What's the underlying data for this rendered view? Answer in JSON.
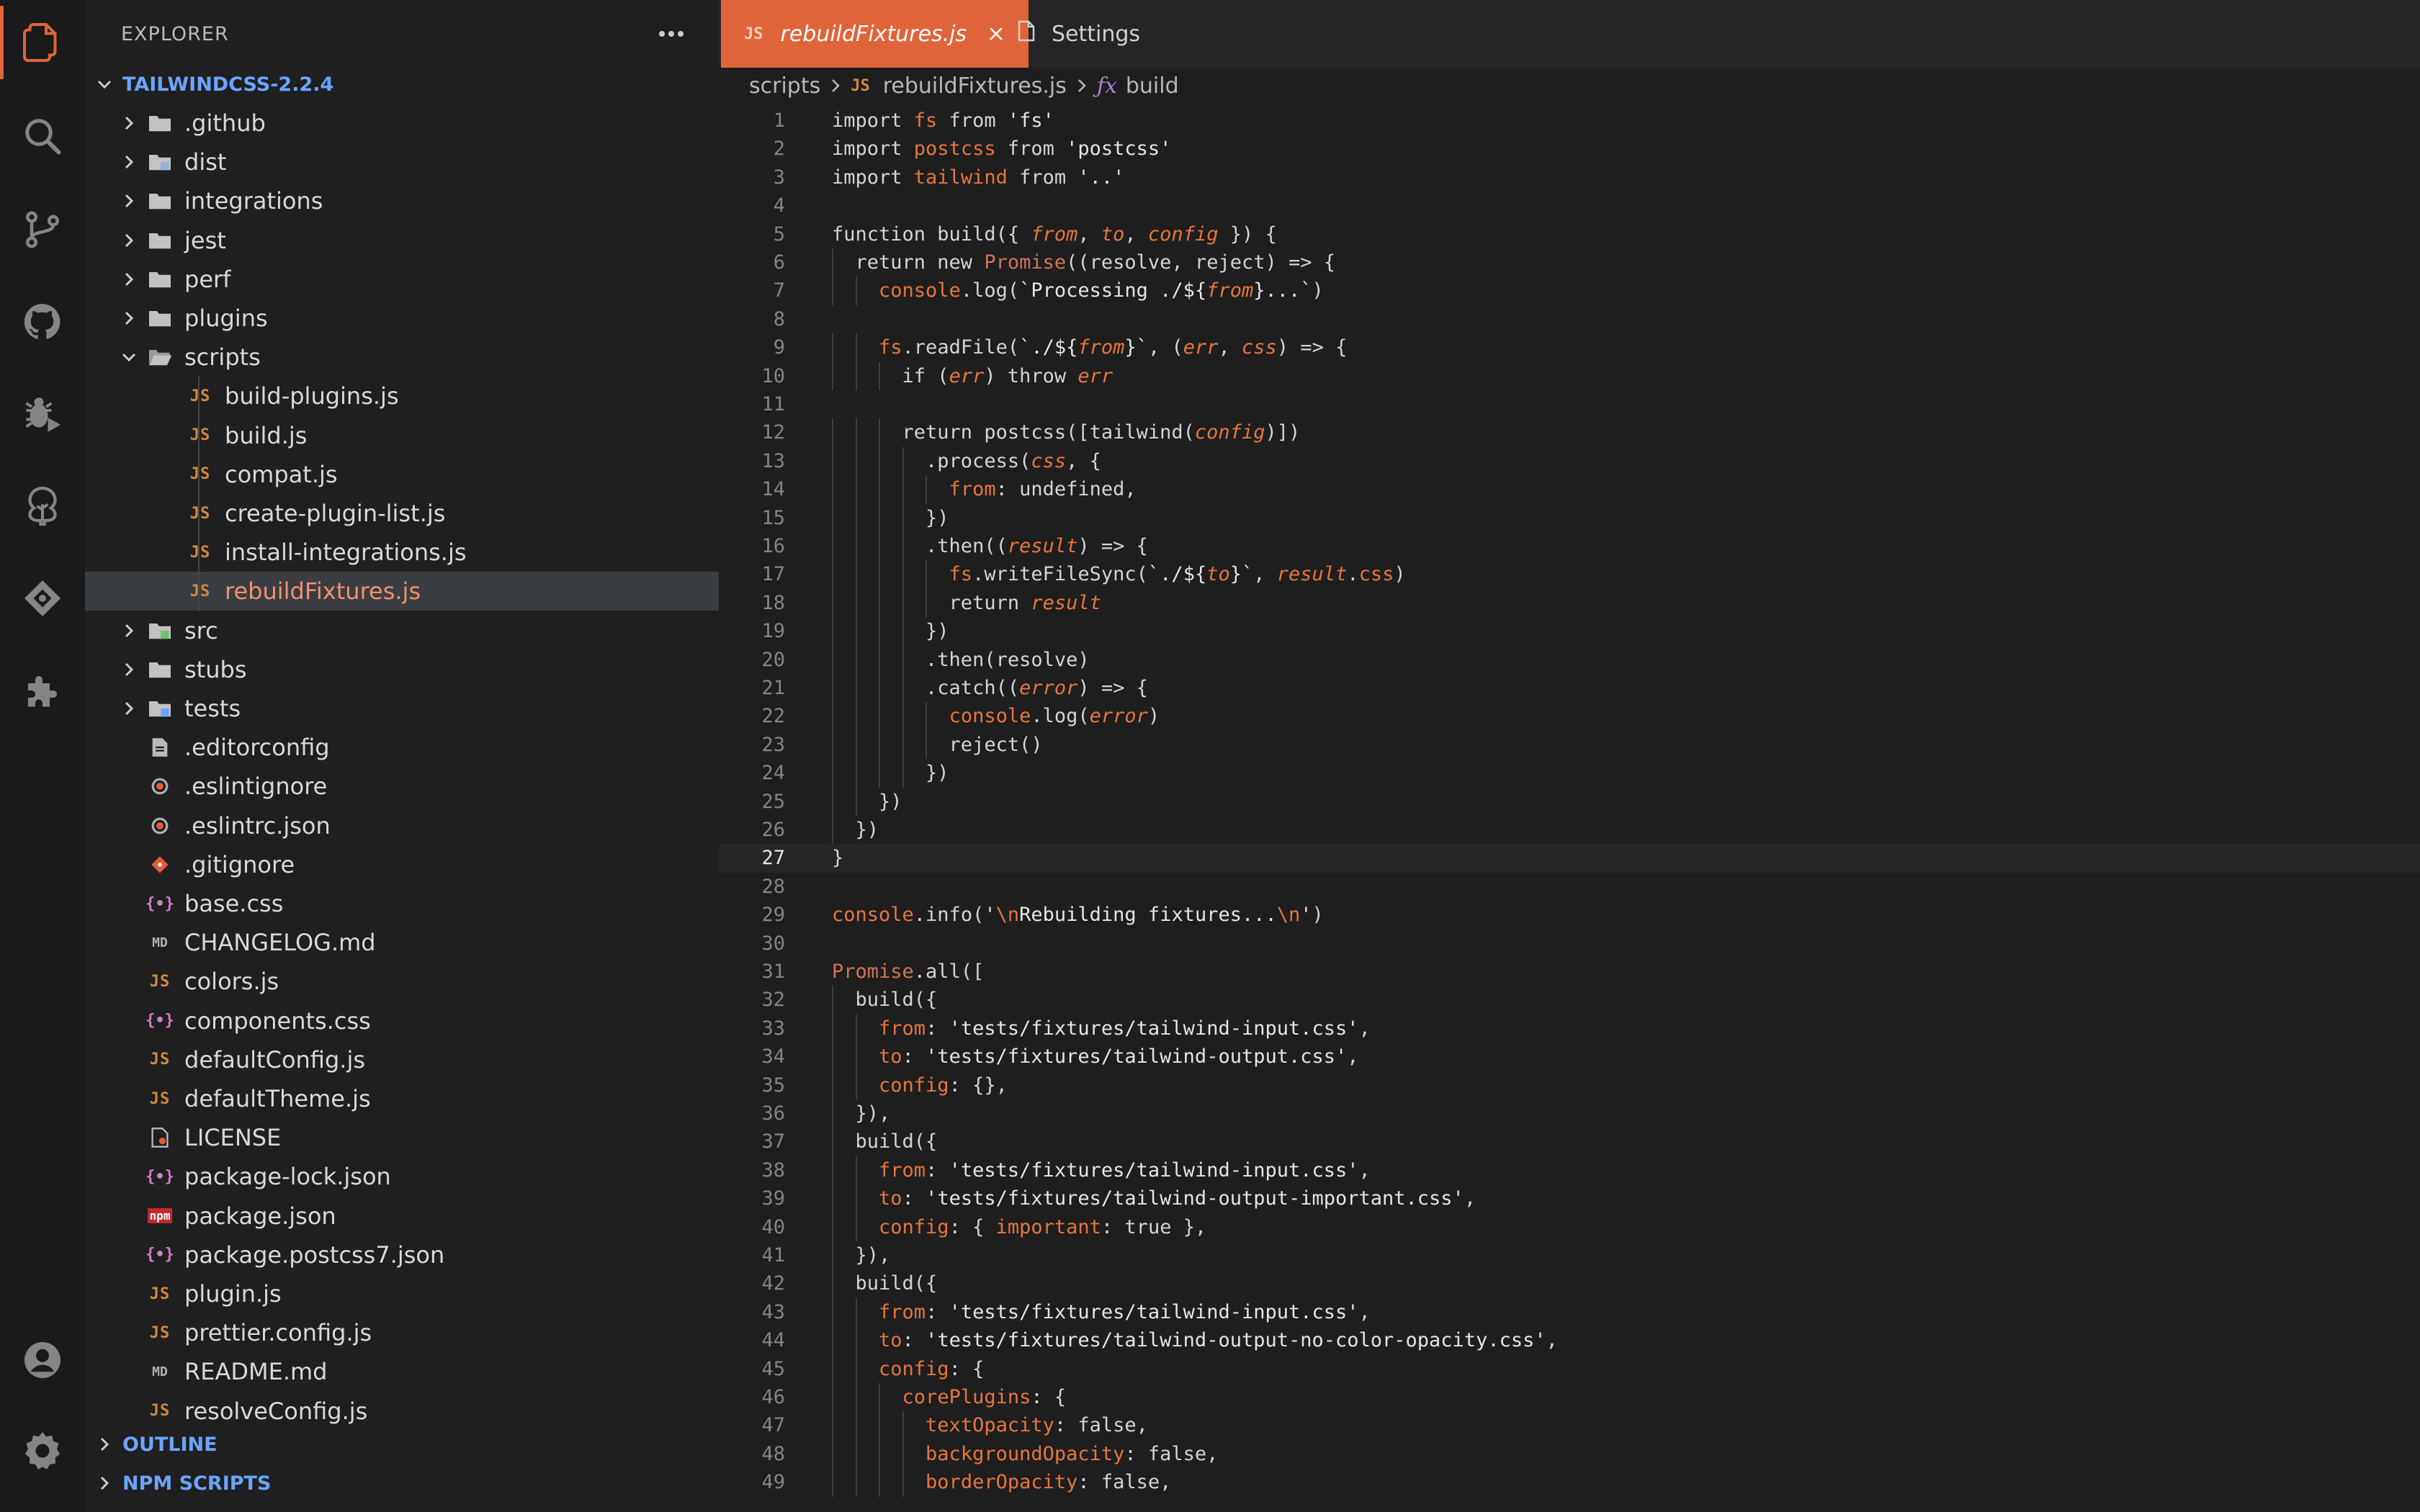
{
  "activity_bar": {
    "items": [
      {
        "name": "explorer-icon",
        "active": true
      },
      {
        "name": "search-icon"
      },
      {
        "name": "source-control-icon"
      },
      {
        "name": "github-icon"
      },
      {
        "name": "run-debug-icon"
      },
      {
        "name": "tree-icon"
      },
      {
        "name": "gitkraken-icon"
      },
      {
        "name": "extensions-icon"
      }
    ],
    "bottom": [
      {
        "name": "account-icon"
      },
      {
        "name": "manage-gear-icon"
      }
    ]
  },
  "sidebar": {
    "title": "EXPLORER",
    "more_icon": "ellipsis-icon",
    "root_label": "TAILWINDCSS-2.2.4",
    "items": [
      {
        "label": ".github",
        "kind": "folder",
        "depth": 1,
        "expanded": false
      },
      {
        "label": "dist",
        "kind": "folder-special",
        "depth": 1,
        "expanded": false
      },
      {
        "label": "integrations",
        "kind": "folder",
        "depth": 1,
        "expanded": false
      },
      {
        "label": "jest",
        "kind": "folder",
        "depth": 1,
        "expanded": false
      },
      {
        "label": "perf",
        "kind": "folder",
        "depth": 1,
        "expanded": false
      },
      {
        "label": "plugins",
        "kind": "folder",
        "depth": 1,
        "expanded": false
      },
      {
        "label": "scripts",
        "kind": "folder-open",
        "depth": 1,
        "expanded": true
      },
      {
        "label": "build-plugins.js",
        "kind": "js",
        "depth": 2
      },
      {
        "label": "build.js",
        "kind": "js",
        "depth": 2
      },
      {
        "label": "compat.js",
        "kind": "js",
        "depth": 2
      },
      {
        "label": "create-plugin-list.js",
        "kind": "js",
        "depth": 2
      },
      {
        "label": "install-integrations.js",
        "kind": "js",
        "depth": 2
      },
      {
        "label": "rebuildFixtures.js",
        "kind": "js",
        "depth": 2,
        "selected": true
      },
      {
        "label": "src",
        "kind": "folder-src",
        "depth": 1,
        "expanded": false
      },
      {
        "label": "stubs",
        "kind": "folder",
        "depth": 1,
        "expanded": false
      },
      {
        "label": "tests",
        "kind": "folder-test",
        "depth": 1,
        "expanded": false
      },
      {
        "label": ".editorconfig",
        "kind": "editorconfig",
        "depth": 1
      },
      {
        "label": ".eslintignore",
        "kind": "eslint",
        "depth": 1
      },
      {
        "label": ".eslintrc.json",
        "kind": "eslint",
        "depth": 1
      },
      {
        "label": ".gitignore",
        "kind": "git",
        "depth": 1
      },
      {
        "label": "base.css",
        "kind": "brace",
        "depth": 1
      },
      {
        "label": "CHANGELOG.md",
        "kind": "md",
        "depth": 1
      },
      {
        "label": "colors.js",
        "kind": "js",
        "depth": 1
      },
      {
        "label": "components.css",
        "kind": "brace",
        "depth": 1
      },
      {
        "label": "defaultConfig.js",
        "kind": "js",
        "depth": 1
      },
      {
        "label": "defaultTheme.js",
        "kind": "js",
        "depth": 1
      },
      {
        "label": "LICENSE",
        "kind": "license",
        "depth": 1
      },
      {
        "label": "package-lock.json",
        "kind": "brace",
        "depth": 1
      },
      {
        "label": "package.json",
        "kind": "npm",
        "depth": 1
      },
      {
        "label": "package.postcss7.json",
        "kind": "brace",
        "depth": 1
      },
      {
        "label": "plugin.js",
        "kind": "js",
        "depth": 1
      },
      {
        "label": "prettier.config.js",
        "kind": "js",
        "depth": 1
      },
      {
        "label": "README.md",
        "kind": "md",
        "depth": 1
      },
      {
        "label": "resolveConfig.js",
        "kind": "js",
        "depth": 1
      }
    ],
    "sections": [
      {
        "label": "OUTLINE"
      },
      {
        "label": "NPM SCRIPTS"
      }
    ]
  },
  "tabs": [
    {
      "label": "rebuildFixtures.js",
      "badge": "JS",
      "active": true
    },
    {
      "label": "Settings",
      "active": false
    }
  ],
  "breadcrumb": {
    "folder": "scripts",
    "file_badge": "JS",
    "file": "rebuildFixtures.js",
    "symbol_icon": "ƒx",
    "symbol": "build"
  },
  "editor": {
    "current_line": 27,
    "lines": [
      "import fs from 'fs'",
      "import postcss from 'postcss'",
      "import tailwind from '..'",
      "",
      "function build({ from, to, config }) {",
      "  return new Promise((resolve, reject) => {",
      "    console.log(`Processing ./${from}...`)",
      "",
      "    fs.readFile(`./${from}`, (err, css) => {",
      "      if (err) throw err",
      "",
      "      return postcss([tailwind(config)])",
      "        .process(css, {",
      "          from: undefined,",
      "        })",
      "        .then((result) => {",
      "          fs.writeFileSync(`./${to}`, result.css)",
      "          return result",
      "        })",
      "        .then(resolve)",
      "        .catch((error) => {",
      "          console.log(error)",
      "          reject()",
      "        })",
      "    })",
      "  })",
      "}",
      "",
      "console.info('\\nRebuilding fixtures...\\n')",
      "",
      "Promise.all([",
      "  build({",
      "    from: 'tests/fixtures/tailwind-input.css',",
      "    to: 'tests/fixtures/tailwind-output.css',",
      "    config: {},",
      "  }),",
      "  build({",
      "    from: 'tests/fixtures/tailwind-input.css',",
      "    to: 'tests/fixtures/tailwind-output-important.css',",
      "    config: { important: true },",
      "  }),",
      "  build({",
      "    from: 'tests/fixtures/tailwind-input.css',",
      "    to: 'tests/fixtures/tailwind-output-no-color-opacity.css',",
      "    config: {",
      "      corePlugins: {",
      "        textOpacity: false,",
      "        backgroundOpacity: false,",
      "        borderOpacity: false,"
    ]
  }
}
